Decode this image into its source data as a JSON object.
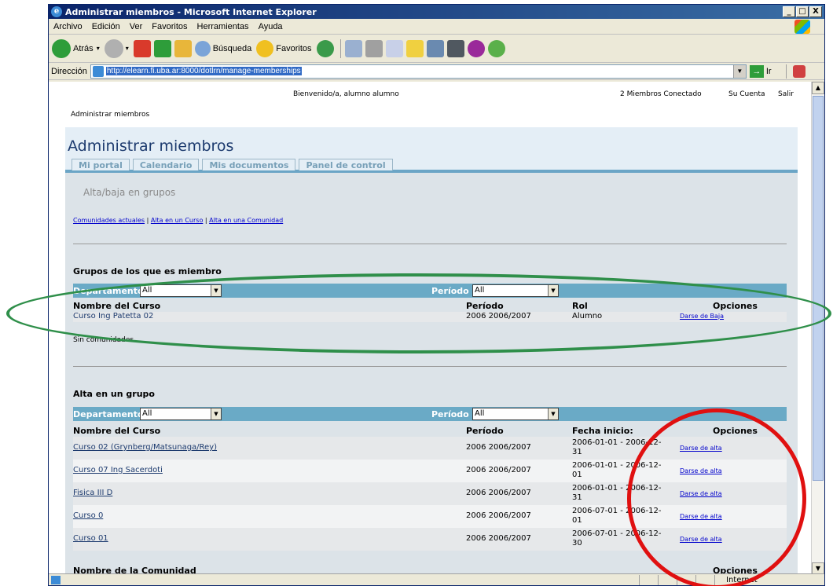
{
  "window": {
    "title": "Administrar miembros - Microsoft Internet Explorer",
    "controls": [
      "_",
      "□",
      "X"
    ]
  },
  "menu": [
    "Archivo",
    "Edición",
    "Ver",
    "Favoritos",
    "Herramientas",
    "Ayuda"
  ],
  "toolbar": {
    "back": "Atrás",
    "search": "Búsqueda",
    "favorites": "Favoritos"
  },
  "address": {
    "label": "Dirección",
    "url": "http://elearn.fi.uba.ar:8000/dotlrn/manage-memberships",
    "go": "Ir"
  },
  "header": {
    "welcome": "Bienvenido/a, alumno alumno",
    "members_online": "2 Miembros Conectado",
    "account": "Su Cuenta",
    "logout": "Salir",
    "breadcrumb": "Administrar miembros"
  },
  "page": {
    "title": "Administrar miembros",
    "tabs": [
      "Mi portal",
      "Calendario",
      "Mis documentos",
      "Panel de control"
    ],
    "subtitle": "Alta/baja en grupos",
    "links": [
      "Comunidades actuales",
      "Alta en un Curso",
      "Alta en una Comunidad"
    ]
  },
  "member_groups": {
    "title": "Grupos de los que es miembro",
    "filter_department": "Departamento:",
    "filter_department_value": "All",
    "filter_period": "Período",
    "filter_period_value": "All",
    "columns": [
      "Nombre del Curso",
      "Período",
      "Rol",
      "Opciones"
    ],
    "rows": [
      {
        "course": "Curso Ing Patetta 02",
        "period": "2006 2006/2007",
        "role": "Alumno",
        "option": "Darse de Baja"
      }
    ],
    "no_communities": "Sin comunidades"
  },
  "join_groups": {
    "title": "Alta en un grupo",
    "filter_department": "Departamento:",
    "filter_department_value": "All",
    "filter_period": "Período",
    "filter_period_value": "All",
    "columns": [
      "Nombre del Curso",
      "Período",
      "Fecha inicio:",
      "Opciones"
    ],
    "rows": [
      {
        "course": "Curso 02 (Grynberg/Matsunaga/Rey)",
        "period": "2006 2006/2007",
        "date1": "2006-01-01 - 2006-12-",
        "date2": "31",
        "option": "Darse de alta"
      },
      {
        "course": "Curso 07 Ing Sacerdoti",
        "period": "2006 2006/2007",
        "date1": "2006-01-01 - 2006-12-",
        "date2": "01",
        "option": "Darse de alta"
      },
      {
        "course": "Fisica III D",
        "period": "2006 2006/2007",
        "date1": "2006-01-01 - 2006-12-",
        "date2": "31",
        "option": "Darse de alta"
      },
      {
        "course": "Curso 0",
        "period": "2006 2006/2007",
        "date1": "2006-07-01 - 2006-12-",
        "date2": "01",
        "option": "Darse de alta"
      },
      {
        "course": "Curso 01",
        "period": "2006 2006/2007",
        "date1": "2006-07-01 - 2006-12-",
        "date2": "30",
        "option": "Darse de alta"
      }
    ],
    "community_header": "Nombre de la Comunidad",
    "community_options": "Opciones"
  },
  "status": {
    "zone": "Internet"
  },
  "colors": {
    "filter_bar": "#6aaac6",
    "annotation_green": "#2f8f4a",
    "annotation_red": "#e01010"
  }
}
